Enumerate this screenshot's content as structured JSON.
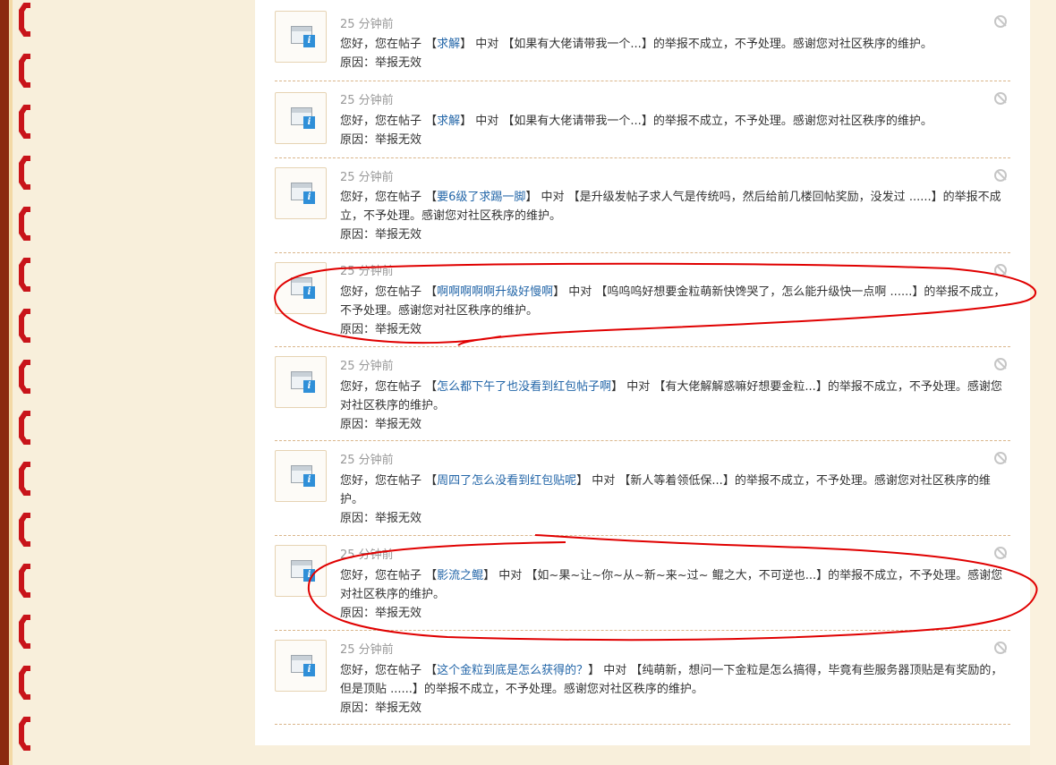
{
  "notices": [
    {
      "time": "25 分钟前",
      "pre": "您好，您在帖子 【",
      "thread": "求解",
      "mid": "】 中对 【如果有大佬请带我一个...】的举报不成立，不予处理。感谢您对社区秩序的维护。",
      "reason": "原因：举报无效"
    },
    {
      "time": "25 分钟前",
      "pre": "您好，您在帖子 【",
      "thread": "求解",
      "mid": "】 中对 【如果有大佬请带我一个...】的举报不成立，不予处理。感谢您对社区秩序的维护。",
      "reason": "原因：举报无效"
    },
    {
      "time": "25 分钟前",
      "pre": "您好，您在帖子 【",
      "thread": "要6级了求踢一脚",
      "mid": "】 中对 【是升级发帖子求人气是传统吗，然后给前几楼回帖奖励，没发过 ......】的举报不成立，不予处理。感谢您对社区秩序的维护。",
      "reason": "原因：举报无效"
    },
    {
      "time": "25 分钟前",
      "pre": "您好，您在帖子 【",
      "thread": "啊啊啊啊啊升级好慢啊",
      "mid": "】 中对 【呜呜呜好想要金粒萌新快馋哭了，怎么能升级快一点啊 ......】的举报不成立，不予处理。感谢您对社区秩序的维护。",
      "reason": "原因：举报无效"
    },
    {
      "time": "25 分钟前",
      "pre": "您好，您在帖子 【",
      "thread": "怎么都下午了也没看到红包帖子啊",
      "mid": "】 中对 【有大佬解解惑嘛好想要金粒...】的举报不成立，不予处理。感谢您对社区秩序的维护。",
      "reason": "原因：举报无效"
    },
    {
      "time": "25 分钟前",
      "pre": "您好，您在帖子 【",
      "thread": "周四了怎么没看到红包贴呢",
      "mid": "】 中对 【新人等着领低保...】的举报不成立，不予处理。感谢您对社区秩序的维护。",
      "reason": "原因：举报无效"
    },
    {
      "time": "25 分钟前",
      "pre": "您好，您在帖子 【",
      "thread": "影流之鲲",
      "mid": "】 中对 【如~果~让~你~从~新~来~过~ 鲲之大，不可逆也...】的举报不成立，不予处理。感谢您对社区秩序的维护。",
      "reason": "原因：举报无效"
    },
    {
      "time": "25 分钟前",
      "pre": "您好，您在帖子 【",
      "thread": "这个金粒到底是怎么获得的？",
      "mid": "】 中对 【纯萌新，想问一下金粒是怎么搞得，毕竟有些服务器顶贴是有奖励的，但是顶贴 ......】的举报不成立，不予处理。感谢您对社区秩序的维护。",
      "reason": "原因：举报无效"
    }
  ],
  "colors": {
    "link": "#2366a8",
    "annotation": "#e00000",
    "border_accent": "#8b2a10"
  }
}
